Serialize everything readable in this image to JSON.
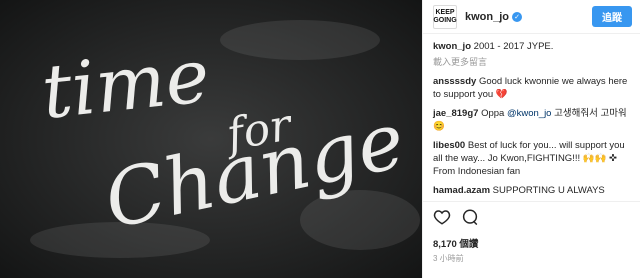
{
  "post": {
    "image": {
      "text_line1": "time",
      "text_line2": "for",
      "text_line3": "Change"
    },
    "header": {
      "avatar_line1": "KEEP",
      "avatar_line2": "GOING",
      "username": "kwon_jo",
      "follow_label": "追蹤"
    },
    "caption": {
      "username": "kwon_jo",
      "text": "2001 - 2017 JYPE."
    },
    "load_more": "載入更多留言",
    "comments": [
      {
        "user": "anssssdy",
        "text": "Good luck kwonnie we always here to support you 💔"
      },
      {
        "user": "jae_819g7",
        "text_pre": "Oppa ",
        "mention": "@kwon_jo",
        "text_post": " 고생해줘서 고마워 😊"
      },
      {
        "user": "libes00",
        "text": "Best of luck for you... will support you all the way... Jo Kwon,FIGHTING!!! 🙌🙌 ✜ From Indonesian fan"
      },
      {
        "user": "hamad.azam",
        "text": "SUPPORTING U ALWAYS"
      }
    ],
    "likes": "8,170 個讚",
    "time": "3 小時前"
  }
}
